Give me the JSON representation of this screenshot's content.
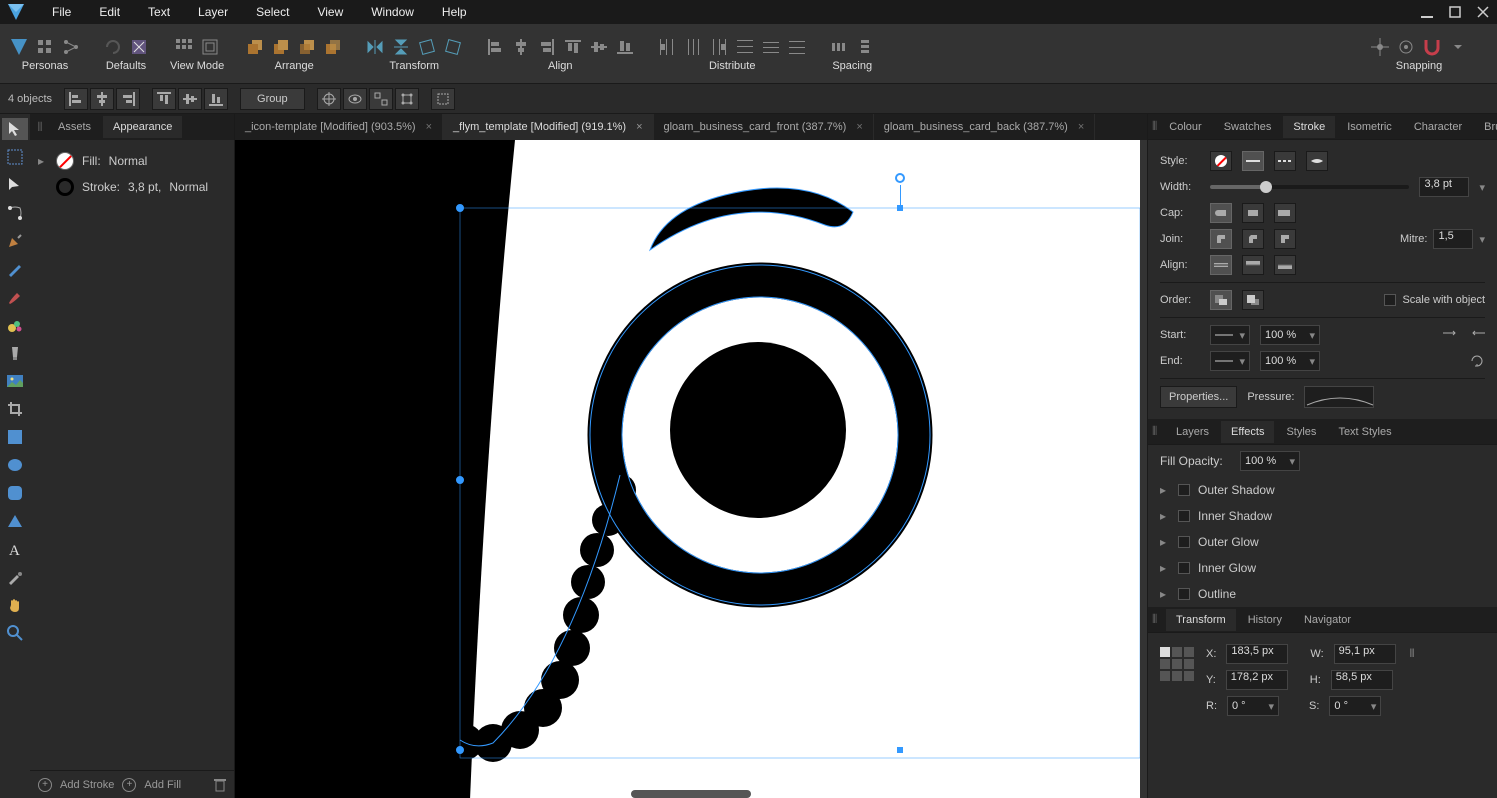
{
  "menu": {
    "items": [
      "File",
      "Edit",
      "Text",
      "Layer",
      "Select",
      "View",
      "Window",
      "Help"
    ]
  },
  "toolbar": {
    "groups": [
      {
        "name": "Personas",
        "label": "Personas"
      },
      {
        "name": "Defaults",
        "label": "Defaults"
      },
      {
        "name": "ViewMode",
        "label": "View Mode"
      },
      {
        "name": "Arrange",
        "label": "Arrange"
      },
      {
        "name": "Transform",
        "label": "Transform"
      },
      {
        "name": "Align",
        "label": "Align"
      },
      {
        "name": "Distribute",
        "label": "Distribute"
      },
      {
        "name": "Spacing",
        "label": "Spacing"
      },
      {
        "name": "Snapping",
        "label": "Snapping"
      }
    ]
  },
  "context": {
    "selection": "4 objects",
    "group_btn": "Group"
  },
  "left_panel": {
    "tabs": [
      "Assets",
      "Appearance"
    ],
    "active_tab": 1,
    "fill_label": "Fill:",
    "fill_value": "Normal",
    "stroke_label": "Stroke:",
    "stroke_width": "3,8 pt,",
    "stroke_value": "Normal",
    "footer_add_stroke": "Add Stroke",
    "footer_add_fill": "Add Fill"
  },
  "doc_tabs": [
    {
      "label": "_icon-template [Modified] (903.5%)",
      "active": false
    },
    {
      "label": "_flym_template [Modified] (919.1%)",
      "active": true
    },
    {
      "label": "gloam_business_card_front (387.7%)",
      "active": false
    },
    {
      "label": "gloam_business_card_back (387.7%)",
      "active": false
    }
  ],
  "right_panel": {
    "tabs1": [
      "Colour",
      "Swatches",
      "Stroke",
      "Isometric",
      "Character",
      "Brushes"
    ],
    "active_tab1": 2,
    "stroke": {
      "style_label": "Style:",
      "width_label": "Width:",
      "width_value": "3,8 pt",
      "cap_label": "Cap:",
      "join_label": "Join:",
      "mitre_label": "Mitre:",
      "mitre_value": "1,5",
      "align_label": "Align:",
      "order_label": "Order:",
      "scale_label": "Scale with object",
      "start_label": "Start:",
      "start_pct": "100 %",
      "end_label": "End:",
      "end_pct": "100 %",
      "properties_btn": "Properties...",
      "pressure_label": "Pressure:"
    },
    "tabs2": [
      "Layers",
      "Effects",
      "Styles",
      "Text Styles"
    ],
    "active_tab2": 1,
    "effects": {
      "fill_opacity_label": "Fill Opacity:",
      "fill_opacity_value": "100 %",
      "items": [
        "Outer Shadow",
        "Inner Shadow",
        "Outer Glow",
        "Inner Glow",
        "Outline"
      ]
    },
    "tabs3": [
      "Transform",
      "History",
      "Navigator"
    ],
    "active_tab3": 0,
    "transform": {
      "x_label": "X:",
      "x_value": "183,5 px",
      "y_label": "Y:",
      "y_value": "178,2 px",
      "w_label": "W:",
      "w_value": "95,1 px",
      "h_label": "H:",
      "h_value": "58,5 px",
      "r_label": "R:",
      "r_value": "0 °",
      "s_label": "S:",
      "s_value": "0 °"
    }
  }
}
